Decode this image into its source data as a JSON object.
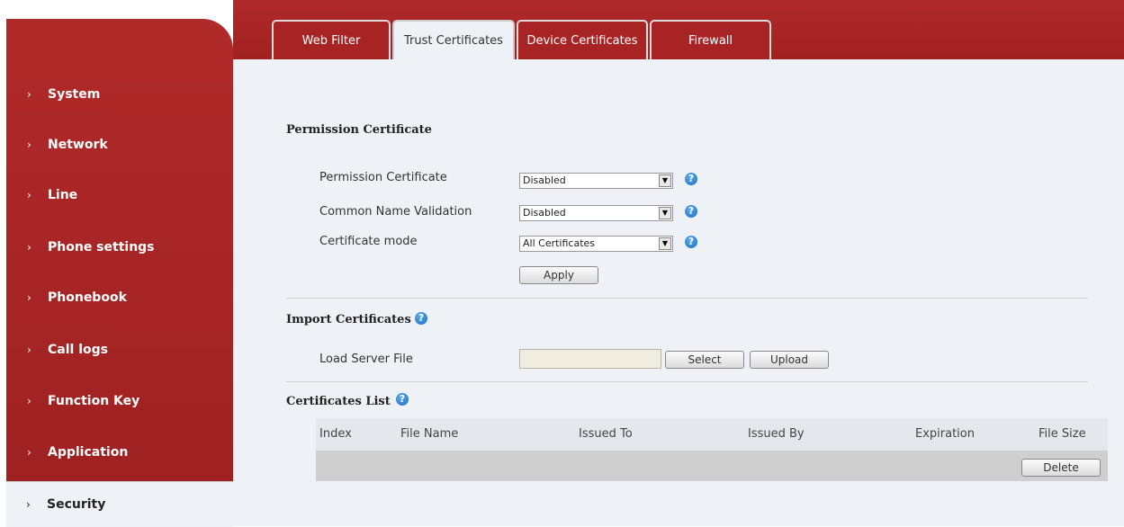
{
  "tabs": [
    "Web Filter",
    "Trust Certificates",
    "Device Certificates",
    "Firewall"
  ],
  "sidebar": {
    "items": [
      "System",
      "Network",
      "Line",
      "Phone settings",
      "Phonebook",
      "Call logs",
      "Function Key",
      "Application",
      "Security"
    ],
    "chevron": "›",
    "active": "Security"
  },
  "permission": {
    "heading": "Permission Certificate",
    "rows": [
      {
        "label": "Permission Certificate",
        "value": "Disabled"
      },
      {
        "label": "Common Name Validation",
        "value": "Disabled"
      },
      {
        "label": "Certificate mode",
        "value": "All Certificates"
      }
    ],
    "apply_label": "Apply"
  },
  "import": {
    "heading": "Import Certificates",
    "load_label": "Load Server File",
    "select_label": "Select",
    "upload_label": "Upload"
  },
  "cert_list": {
    "heading": "Certificates List",
    "columns": [
      "Index",
      "File Name",
      "Issued To",
      "Issued By",
      "Expiration",
      "File Size"
    ],
    "delete_label": "Delete"
  },
  "icons": {
    "help": "?",
    "dropdown": "▼"
  },
  "colors": {
    "brand_red": "#a82424",
    "content_bg": "#eef2f6",
    "help_blue": "#1d6fc0"
  }
}
